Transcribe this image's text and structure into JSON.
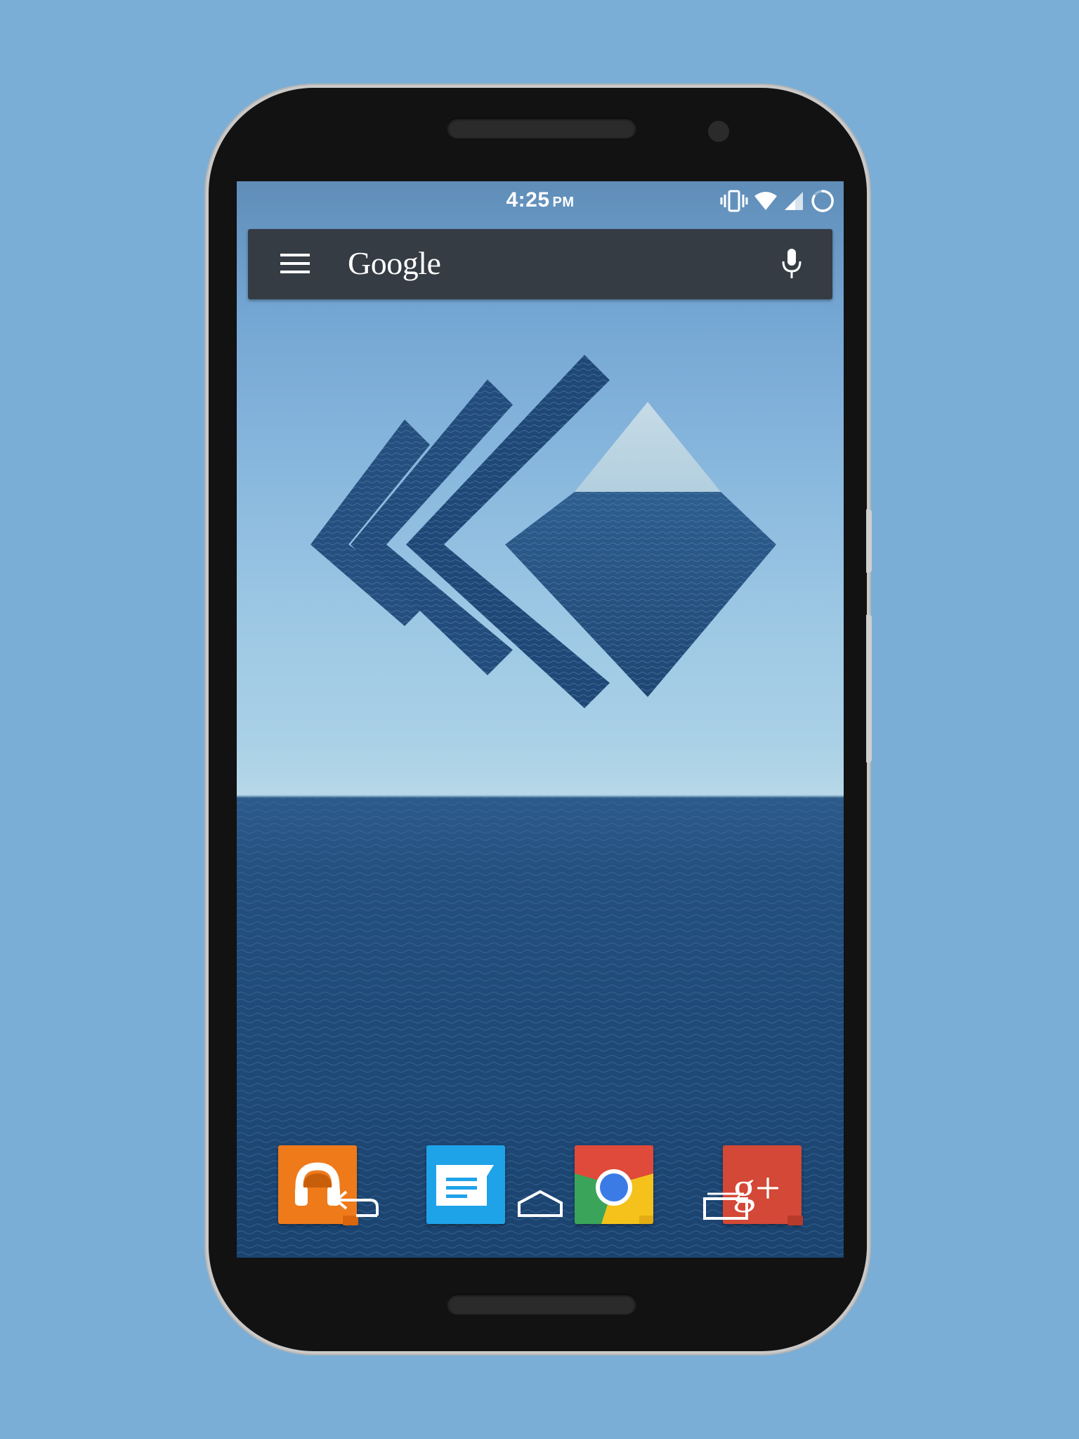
{
  "status_bar": {
    "time": "4:25",
    "ampm": "PM",
    "icons": [
      "vibrate-icon",
      "wifi-icon",
      "signal-icon",
      "battery-charging-icon"
    ]
  },
  "search_bar": {
    "logo_text": "Google",
    "icons": [
      "menu-icon",
      "mic-icon"
    ]
  },
  "dock": {
    "apps": [
      {
        "name": "Play Music",
        "icon": "headphones-icon",
        "color": "#ef7a1a"
      },
      {
        "name": "Messenger",
        "icon": "message-icon",
        "color": "#1fa3e8"
      },
      {
        "name": "Chrome",
        "icon": "chrome-icon",
        "color": "#e04a3a"
      },
      {
        "name": "Google+",
        "icon": "google-plus-icon",
        "color": "#d34836"
      }
    ]
  },
  "nav_bar": {
    "buttons": [
      "back-icon",
      "home-icon",
      "recents-icon"
    ]
  },
  "colors": {
    "background": "#7aaed6",
    "phone_body": "#121212",
    "search_bar": "#353c44"
  }
}
